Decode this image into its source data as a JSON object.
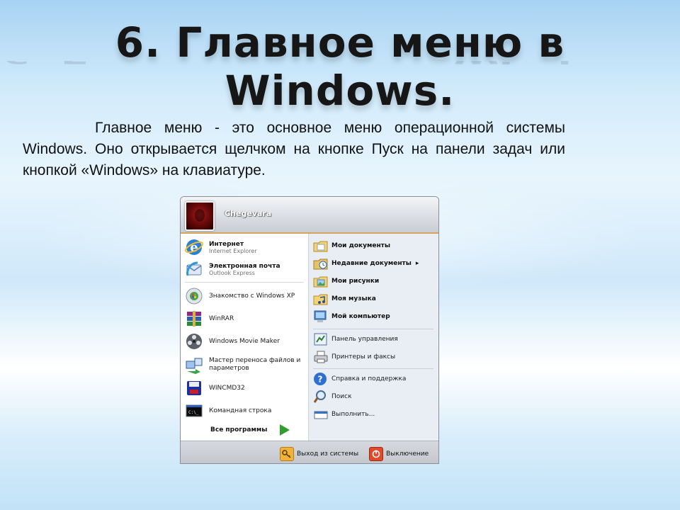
{
  "slide": {
    "title": "6. Главное меню в Windows.",
    "paragraph_1": "Главное меню - это основное меню операционной системы Windows. Оно открывается щелчком на кнопке Пуск на панели задач или кнопкой «Windows»  на клавиатуре."
  },
  "start_menu": {
    "user_name": "Chegevara",
    "left_items": [
      {
        "title": "Интернет",
        "subtitle": "Internet Explorer",
        "icon": "internet-explorer-icon"
      },
      {
        "title": "Электронная почта",
        "subtitle": "Outlook Express",
        "icon": "outlook-express-icon"
      },
      {
        "label": "Знакомство с Windows XP",
        "icon": "windows-tour-icon"
      },
      {
        "label": "WinRAR",
        "icon": "winrar-icon"
      },
      {
        "label": "Windows Movie Maker",
        "icon": "movie-maker-icon"
      },
      {
        "label": "Мастер переноса файлов и параметров",
        "icon": "transfer-wizard-icon"
      },
      {
        "label": "WINCMD32",
        "icon": "wincmd-icon"
      },
      {
        "label": "Командная строка",
        "icon": "command-prompt-icon"
      }
    ],
    "all_programs": "Все программы",
    "right_items": [
      {
        "label": "Мои документы",
        "icon": "my-documents-icon",
        "bold": true
      },
      {
        "label": "Недавние документы",
        "icon": "recent-documents-icon",
        "bold": true,
        "submenu_arrow": "▸"
      },
      {
        "label": "Мои рисунки",
        "icon": "my-pictures-icon",
        "bold": true
      },
      {
        "label": "Моя музыка",
        "icon": "my-music-icon",
        "bold": true
      },
      {
        "label": "Мой компьютер",
        "icon": "my-computer-icon",
        "bold": true
      },
      {
        "label": "Панель управления",
        "icon": "control-panel-icon",
        "bold": false
      },
      {
        "label": "Принтеры и факсы",
        "icon": "printers-icon",
        "bold": false
      },
      {
        "label": "Справка и поддержка",
        "icon": "help-icon",
        "bold": false
      },
      {
        "label": "Поиск",
        "icon": "search-icon",
        "bold": false
      },
      {
        "label": "Выполнить...",
        "icon": "run-icon",
        "bold": false
      }
    ],
    "footer": {
      "logoff": "Выход из системы",
      "shutdown": "Выключение"
    }
  }
}
